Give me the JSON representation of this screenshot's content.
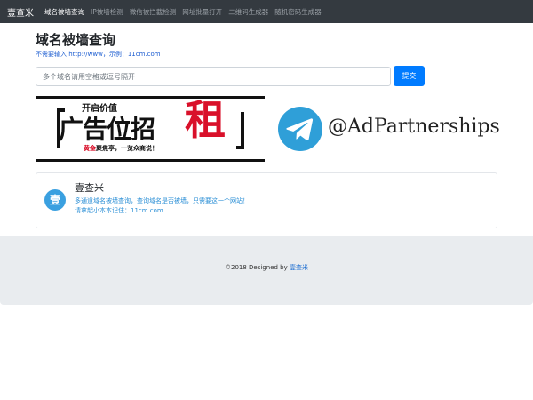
{
  "navbar": {
    "brand": "壹查米",
    "links": [
      {
        "label": "域名被墙查询",
        "active": true
      },
      {
        "label": "IP被墙检测",
        "active": false
      },
      {
        "label": "微信被拦截检测",
        "active": false
      },
      {
        "label": "网址批量打开",
        "active": false
      },
      {
        "label": "二维码生成器",
        "active": false
      },
      {
        "label": "随机密码生成器",
        "active": false
      }
    ]
  },
  "main": {
    "title": "域名被墙查询",
    "hint": "不需要输入 http://www，示例：11cm.com",
    "search_placeholder": "多个域名请用空格或逗号隔开",
    "search_value": "",
    "submit_label": "提交"
  },
  "ads": {
    "left": {
      "top_text": "开启价值",
      "main_text": "广告位招",
      "highlight_text": "租",
      "sub_red": "黄金",
      "sub_text": "聚焦亭，一览众商说！"
    },
    "right": {
      "icon": "telegram-icon",
      "handle": "@AdPartnerships"
    }
  },
  "card": {
    "avatar_char": "壹",
    "title": "壹查米",
    "line1": "多通道域名被墙查询，查询域名是否被墙，只需要这一个网站！",
    "line2": "请拿起小本本记住：11cm.com"
  },
  "footer": {
    "prefix": "©2018 Designed by ",
    "link": "壹查米"
  },
  "colors": {
    "navbar_bg": "#343a40",
    "primary": "#007bff",
    "ad_red": "#d9102a",
    "telegram_blue": "#2f9fd8",
    "footer_bg": "#e9ecef"
  }
}
